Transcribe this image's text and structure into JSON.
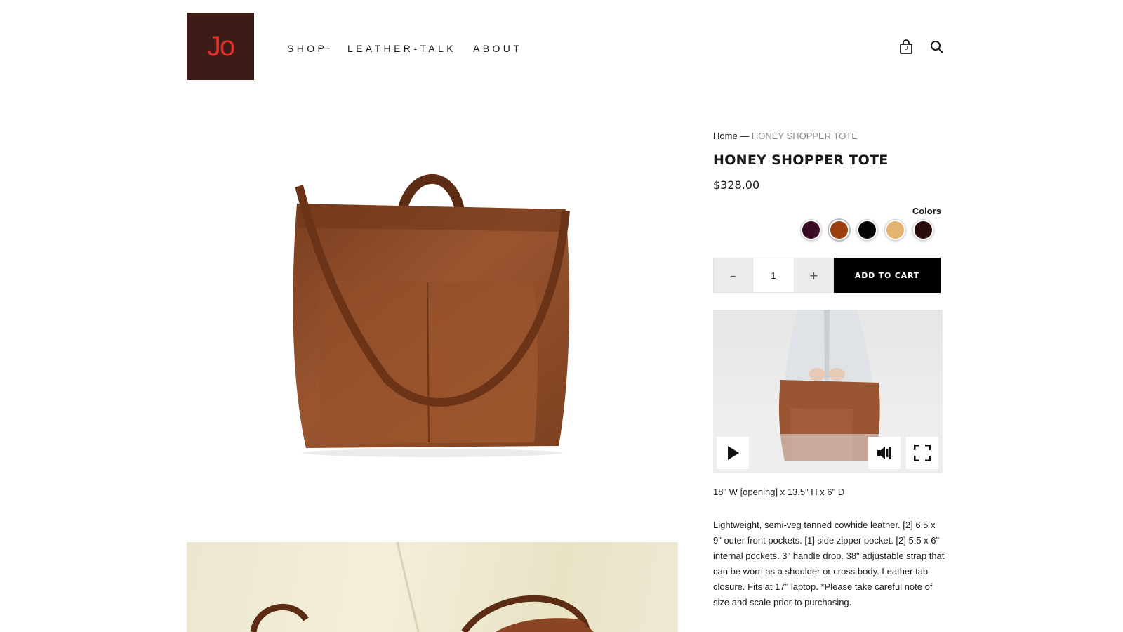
{
  "brand": {
    "logo_text": "Jo"
  },
  "nav": {
    "items": [
      {
        "label": "SHOP",
        "has_dropdown": true
      },
      {
        "label": "LEATHER-TALK",
        "has_dropdown": false
      },
      {
        "label": "ABOUT",
        "has_dropdown": false
      }
    ]
  },
  "header": {
    "cart_count": "0",
    "cart_icon": "shopping-bag-icon",
    "search_icon": "search-icon"
  },
  "breadcrumb": {
    "home": "Home",
    "separator": " — ",
    "current": "HONEY SHOPPER TOTE"
  },
  "product": {
    "title": "HONEY SHOPPER TOTE",
    "price": "$328.00",
    "colors_label": "Colors",
    "colors": [
      {
        "name": "plum",
        "hex": "#3a0a26",
        "selected": false
      },
      {
        "name": "honey",
        "hex": "#9c3f0e",
        "selected": true
      },
      {
        "name": "black",
        "hex": "#050505",
        "selected": false
      },
      {
        "name": "tan",
        "hex": "#e3b470",
        "selected": false
      },
      {
        "name": "black-brown",
        "hex": "#2a0c0c",
        "selected": false
      }
    ],
    "quantity": "1",
    "qty_minus": "–",
    "qty_plus": "+",
    "add_to_cart": "ADD TO CART",
    "dimensions": "18\" W [opening] x 13.5\" H x 6\" D",
    "description": "Lightweight, semi-veg tanned cowhide leather. [2] 6.5 x 9\" outer front pockets. [1] side zipper pocket. [2] 5.5 x 6\" internal pockets. 3\" handle drop. 38\" adjustable strap that can be worn as a shoulder or cross body. Leather tab closure. Fits at 17\" laptop. *Please take careful note of size and scale prior to purchasing."
  },
  "video": {
    "controls": [
      "play-icon",
      "volume-icon",
      "fullscreen-icon"
    ]
  },
  "colors": {
    "logo_bg": "#3d1c17",
    "logo_text": "#e0302b",
    "leather": "#8c4a26",
    "button_bg": "#000000"
  }
}
